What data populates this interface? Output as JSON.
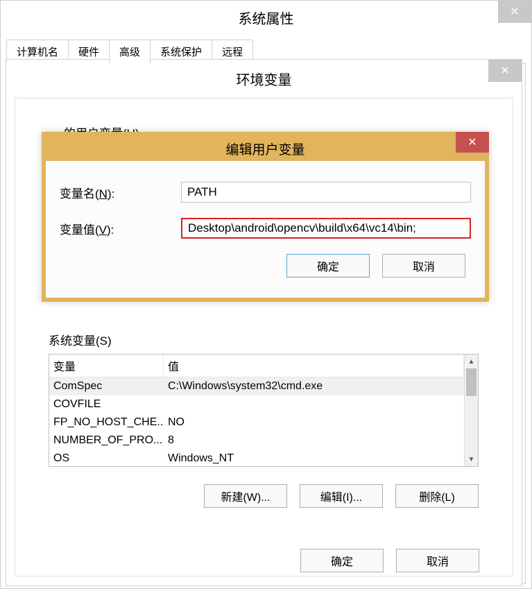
{
  "main_window": {
    "title": "系统属性",
    "tabs": [
      "计算机名",
      "硬件",
      "高级",
      "系统保护",
      "远程"
    ],
    "active_tab_index": 2
  },
  "env_dialog": {
    "title": "环境变量",
    "user_vars_partial_label": "的用户变量(U)",
    "sysvars_label": "系统变量(S)",
    "table_headers": {
      "var": "变量",
      "val": "值"
    },
    "sysvars": [
      {
        "var": "ComSpec",
        "val": "C:\\Windows\\system32\\cmd.exe",
        "selected": true
      },
      {
        "var": "COVFILE",
        "val": ""
      },
      {
        "var": "FP_NO_HOST_CHE...",
        "val": "NO"
      },
      {
        "var": "NUMBER_OF_PRO...",
        "val": "8"
      },
      {
        "var": "OS",
        "val": "Windows_NT"
      }
    ],
    "buttons": {
      "new": "新建(W)...",
      "edit": "编辑(I)...",
      "delete": "删除(L)"
    },
    "bottom_buttons": {
      "ok": "确定",
      "cancel": "取消"
    }
  },
  "edit_dialog": {
    "title": "编辑用户变量",
    "name_label_pre": "变量名(",
    "name_label_u": "N",
    "name_label_post": "):",
    "value_label_pre": "变量值(",
    "value_label_u": "V",
    "value_label_post": "):",
    "name_value": "PATH",
    "value_value": "Desktop\\android\\opencv\\build\\x64\\vc14\\bin;",
    "buttons": {
      "ok": "确定",
      "cancel": "取消"
    }
  },
  "glyphs": {
    "close": "✕",
    "up": "▲",
    "down": "▼"
  }
}
